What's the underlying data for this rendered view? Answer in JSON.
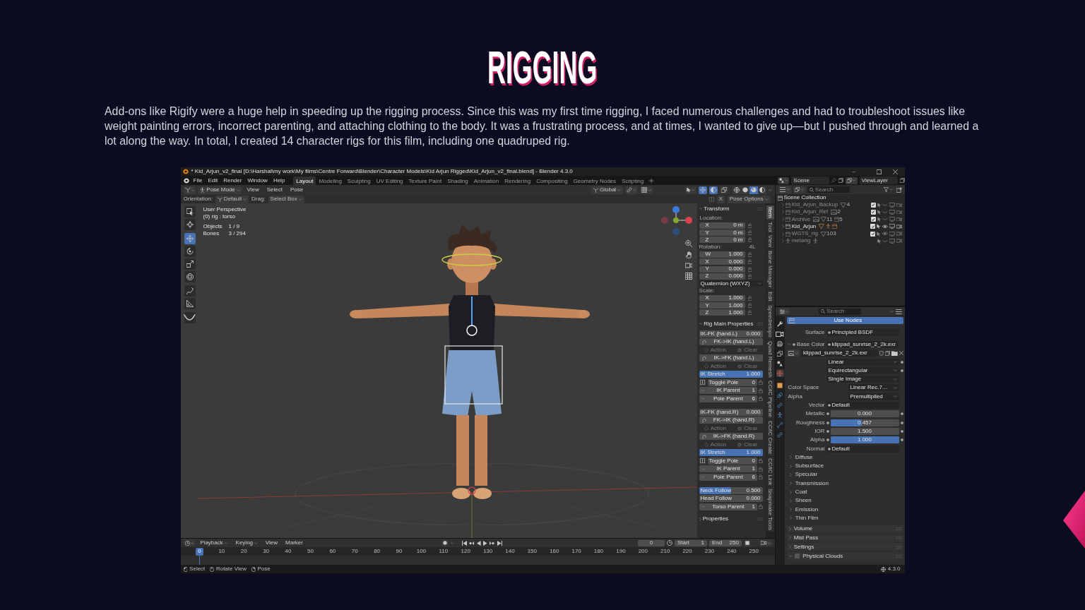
{
  "heading": "RIGGING",
  "intro": "Add-ons like Rigify were a huge help in speeding up the rigging process. Since this was my first time rigging, I faced numerous challenges and had to troubleshoot issues like weight painting errors, incorrect parenting, and attaching clothing to the body. It was a frustrating process, and at times, I wanted to give up—but I pushed through and learned a lot along the way. In total, I created 14 character rigs for this film, including one quadruped rig.",
  "app": {
    "title": "* Kid_Arjun_v2_final [D:\\Harshal\\my work\\My films\\Centre Forward\\Blender\\Character Models\\Kid Arjun Rigged\\Kid_Arjun_v2_final.blend] - Blender 4.3.0",
    "menu": [
      "File",
      "Edit",
      "Render",
      "Window",
      "Help"
    ],
    "workspaces": [
      {
        "label": "Layout",
        "selected": true
      },
      {
        "label": "Modeling",
        "selected": false
      },
      {
        "label": "Sculpting",
        "selected": false
      },
      {
        "label": "UV Editing",
        "selected": false
      },
      {
        "label": "Texture Paint",
        "selected": false
      },
      {
        "label": "Shading",
        "selected": false
      },
      {
        "label": "Animation",
        "selected": false
      },
      {
        "label": "Rendering",
        "selected": false
      },
      {
        "label": "Compositing",
        "selected": false
      },
      {
        "label": "Geometry Nodes",
        "selected": false
      },
      {
        "label": "Scripting",
        "selected": false
      }
    ],
    "scene": "Scene",
    "view_layer": "ViewLayer",
    "viewport": {
      "mode": "Pose Mode",
      "menus": [
        "View",
        "Select",
        "Pose"
      ],
      "transform_orientation": "Global",
      "toggles": [
        {
          "kind": "gizmo",
          "on": true
        },
        {
          "kind": "overlay",
          "on": true
        },
        {
          "kind": "xray",
          "on": false
        }
      ],
      "shading": [
        {
          "kind": "wireframe",
          "selected": false
        },
        {
          "kind": "solid",
          "selected": false
        },
        {
          "kind": "material",
          "selected": true
        },
        {
          "kind": "rendered",
          "selected": false
        }
      ],
      "orientation_label": "Orientation:",
      "orientation": "Default",
      "drag_label": "Drag:",
      "drag": "Select Box",
      "mirror": "X",
      "pose_options": "Pose Options",
      "tools": [
        {
          "kind": "select",
          "selected": false
        },
        {
          "kind": "cursor",
          "selected": false
        },
        {
          "kind": "move",
          "selected": true
        },
        {
          "kind": "rotate",
          "selected": false
        },
        {
          "kind": "scale",
          "selected": false
        },
        {
          "kind": "transform",
          "selected": false
        },
        {
          "kind": "annotate",
          "selected": false
        },
        {
          "kind": "measure",
          "selected": false
        },
        {
          "kind": "roll",
          "selected": false
        }
      ],
      "view_name": "User Perspective",
      "active": "(0) rig : torso",
      "stats": [
        {
          "label": "Objects",
          "value": "1 / 9"
        },
        {
          "label": "Bones",
          "value": "3 / 294"
        }
      ]
    },
    "sidebar": {
      "tabs": [
        {
          "label": "Item",
          "selected": true
        },
        {
          "label": "Tool",
          "selected": false
        },
        {
          "label": "View",
          "selected": false
        },
        {
          "label": "Bone Manager",
          "selected": false
        },
        {
          "label": "Edit",
          "selected": false
        },
        {
          "label": "Speedretopo",
          "selected": false
        },
        {
          "label": "Quad Remesh",
          "selected": false
        },
        {
          "label": "CC/iC Pipeline",
          "selected": false
        },
        {
          "label": "CC/iC Create",
          "selected": false
        },
        {
          "label": "CC/iC Link",
          "selected": false
        },
        {
          "label": "Snapmake Tools",
          "selected": false
        }
      ],
      "transform": {
        "title": "Transform",
        "expanded": true,
        "groups": [
          {
            "label": "Location:",
            "fields": [
              {
                "axis": "X",
                "value": "0 m"
              },
              {
                "axis": "Y",
                "value": "0 m"
              },
              {
                "axis": "Z",
                "value": "0 m"
              }
            ]
          },
          {
            "label": "Rotation:",
            "note": "4L",
            "fields": [
              {
                "axis": "W",
                "value": "1.000"
              },
              {
                "axis": "X",
                "value": "0.000"
              },
              {
                "axis": "Y",
                "value": "0.000"
              },
              {
                "axis": "Z",
                "value": "0.000"
              }
            ],
            "mode": "Quaternion (WXYZ)"
          },
          {
            "label": "Scale:",
            "fields": [
              {
                "axis": "X",
                "value": "1.000"
              },
              {
                "axis": "Y",
                "value": "1.000"
              },
              {
                "axis": "Z",
                "value": "1.000"
              }
            ]
          }
        ]
      },
      "rig": {
        "title": "Rig Main Properties",
        "expanded": true,
        "groups": [
          {
            "rows": [
              {
                "kind": "number",
                "label": "IK-FK (hand.L)",
                "value": "0.000"
              },
              {
                "kind": "operator",
                "label": "FK->IK (hand.L)"
              },
              {
                "kind": "action",
                "labels": [
                  "Action",
                  "Clear"
                ]
              },
              {
                "kind": "operator",
                "label": "IK->FK (hand.L)"
              },
              {
                "kind": "action",
                "labels": [
                  "Action",
                  "Clear"
                ]
              },
              {
                "kind": "slider",
                "label": "IK Stretch",
                "value": "1.000",
                "level": 1
              },
              {
                "kind": "toggle",
                "label": "Toggle Pole",
                "value": "0"
              },
              {
                "kind": "enum",
                "label": "IK Parent",
                "value": "1"
              },
              {
                "kind": "enum",
                "label": "Pole Parent",
                "value": "6"
              }
            ]
          },
          {
            "rows": [
              {
                "kind": "number",
                "label": "IK-FK (hand.R)",
                "value": "0.000"
              },
              {
                "kind": "operator",
                "label": "FK->IK (hand.R)"
              },
              {
                "kind": "action",
                "labels": [
                  "Action",
                  "Clear"
                ]
              },
              {
                "kind": "operator",
                "label": "IK->FK (hand.R)"
              },
              {
                "kind": "action",
                "labels": [
                  "Action",
                  "Clear"
                ]
              },
              {
                "kind": "slider",
                "label": "IK Stretch",
                "value": "1.000",
                "level": 1
              },
              {
                "kind": "toggle",
                "label": "Toggle Pole",
                "value": "0"
              },
              {
                "kind": "enum",
                "label": "IK Parent",
                "value": "1"
              },
              {
                "kind": "enum",
                "label": "Pole Parent",
                "value": "6"
              }
            ]
          },
          {
            "rows": [
              {
                "kind": "slider",
                "label": "Neck Follow",
                "value": "0.500",
                "level": 0.5
              },
              {
                "kind": "number",
                "label": "Head Follow",
                "value": "0.000"
              },
              {
                "kind": "enum",
                "label": "Torso Parent",
                "value": "1"
              }
            ]
          }
        ]
      },
      "more": [
        {
          "label": "Properties",
          "expanded": false
        }
      ]
    },
    "outliner": {
      "search": "Search",
      "root": "Scene Collection",
      "items": [
        {
          "kind": "collection",
          "name": "Kid_Arjun_Backup",
          "dimmed": true,
          "checked": true,
          "visible": false,
          "contents": [
            {
              "kind": "mesh",
              "count": "4"
            }
          ]
        },
        {
          "kind": "collection",
          "name": "Kid_Arjun_Ref",
          "dimmed": true,
          "checked": true,
          "visible": false,
          "contents": [
            {
              "kind": "image",
              "count": "2"
            }
          ]
        },
        {
          "kind": "collection",
          "name": "Archive",
          "dimmed": true,
          "checked": true,
          "visible": false,
          "contents": [
            {
              "kind": "image"
            },
            {
              "kind": "mesh",
              "count": "11"
            },
            {
              "kind": "collection",
              "count": "5"
            }
          ]
        },
        {
          "kind": "collection",
          "name": "Kid_Arjun",
          "dimmed": false,
          "checked": true,
          "visible": true,
          "contents": [
            {
              "kind": "mesh"
            },
            {
              "kind": "armature"
            },
            {
              "kind": "collection"
            }
          ]
        },
        {
          "kind": "collection",
          "name": "WGTS_rig",
          "dimmed": true,
          "checked": true,
          "visible": true,
          "contents": [
            {
              "kind": "mesh",
              "count": "103"
            }
          ]
        },
        {
          "kind": "object",
          "name": "metarig",
          "dimmed": true,
          "visible": false,
          "contents": [
            {
              "kind": "armature"
            }
          ]
        }
      ]
    },
    "properties": {
      "search": "Search",
      "tabs": [
        {
          "kind": "tool",
          "selected": false
        },
        {
          "kind": "render",
          "selected": false
        },
        {
          "kind": "output",
          "selected": false
        },
        {
          "kind": "view_layer",
          "selected": false
        },
        {
          "kind": "scene",
          "selected": false
        },
        {
          "kind": "world",
          "selected": true
        },
        {
          "kind": "object",
          "selected": false
        },
        {
          "kind": "physics",
          "selected": false
        },
        {
          "kind": "constraint",
          "selected": false
        },
        {
          "kind": "data",
          "selected": false
        },
        {
          "kind": "bone",
          "selected": false
        },
        {
          "kind": "bone_constraint",
          "selected": false
        }
      ],
      "rows": [
        {
          "kind": "button",
          "label": "Use Nodes",
          "on": true
        },
        {
          "kind": "socket",
          "label": "Surface",
          "value": "Principled BSDF"
        },
        {
          "kind": "socket",
          "label": "Base Color",
          "value": "klippad_sunrise_2_2k.exr",
          "expanded": true
        },
        {
          "kind": "image",
          "value": "klippad_sunrise_2_2k.exr"
        },
        {
          "kind": "select",
          "value": "Linear",
          "dot": true
        },
        {
          "kind": "select",
          "value": "Equirectangular",
          "dot": true
        },
        {
          "kind": "select",
          "value": "Single Image",
          "dot": false
        },
        {
          "kind": "select",
          "label": "Color Space",
          "value": "Linear Rec.7…",
          "dot": false
        },
        {
          "kind": "select",
          "label": "Alpha",
          "value": "Premultiplied",
          "dot": false
        },
        {
          "kind": "socket",
          "label": "Vector",
          "value": "Default"
        },
        {
          "kind": "number",
          "label": "Metallic",
          "value": "0.000"
        },
        {
          "kind": "slider",
          "label": "Roughness",
          "value": "0.457",
          "level": 0.457
        },
        {
          "kind": "number",
          "label": "IOR",
          "value": "1.500"
        },
        {
          "kind": "slider",
          "label": "Alpha",
          "value": "1.000",
          "level": 1
        },
        {
          "kind": "socket",
          "label": "Normal",
          "value": "Default"
        },
        {
          "kind": "subpanel",
          "label": "Diffuse",
          "expanded": false
        },
        {
          "kind": "subpanel",
          "label": "Subsurface",
          "expanded": false
        },
        {
          "kind": "subpanel",
          "label": "Specular",
          "expanded": false
        },
        {
          "kind": "subpanel",
          "label": "Transmission",
          "expanded": false
        },
        {
          "kind": "subpanel",
          "label": "Coat",
          "expanded": false
        },
        {
          "kind": "subpanel",
          "label": "Sheen",
          "expanded": false
        },
        {
          "kind": "subpanel",
          "label": "Emission",
          "expanded": false
        },
        {
          "kind": "subpanel",
          "label": "Thin Film",
          "expanded": false
        },
        {
          "kind": "panel",
          "label": "Volume",
          "expanded": false
        },
        {
          "kind": "panel",
          "label": "Mist Pass",
          "expanded": false
        },
        {
          "kind": "panel",
          "label": "Settings",
          "expanded": false
        },
        {
          "kind": "panel",
          "label": "Physical Clouds",
          "expanded": true,
          "checked": false
        }
      ]
    },
    "timeline": {
      "dropdowns": [
        "Playback",
        "Keying"
      ],
      "menus": [
        "View",
        "Marker"
      ],
      "current_frame": "0",
      "start_label": "Start",
      "start": "1",
      "end_label": "End",
      "end": "250",
      "playhead": "0",
      "ticks": [
        "10",
        "20",
        "30",
        "40",
        "50",
        "60",
        "70",
        "80",
        "90",
        "100",
        "110",
        "120",
        "130",
        "140",
        "150",
        "160",
        "170",
        "180",
        "190",
        "200",
        "210",
        "220",
        "230",
        "240",
        "250"
      ]
    },
    "status_bar": {
      "hints": [
        {
          "kind": "left",
          "label": "Select"
        },
        {
          "kind": "middle",
          "label": "Rotate View"
        },
        {
          "kind": "right",
          "label": "Pose"
        }
      ],
      "version": "4.3.0"
    }
  }
}
